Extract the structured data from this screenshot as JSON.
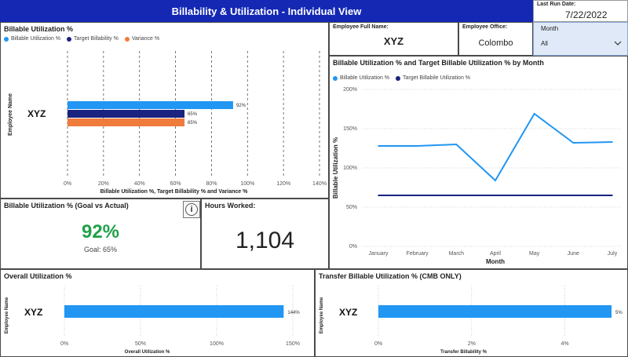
{
  "header": {
    "title": "Billability & Utilization - Individual View",
    "last_run_label": "Last Run Date:",
    "last_run_value": "7/22/2022",
    "brand_color": "#1428b4"
  },
  "filters": {
    "employee_name_label": "Employee Full Name:",
    "employee_name_value": "XYZ",
    "office_label": "Employee Office:",
    "office_value": "Colombo",
    "month_label": "Month",
    "month_value": "All"
  },
  "colors": {
    "billable": "#2196f3",
    "target": "#1a237e",
    "variance": "#ef7b3c",
    "goal_green": "#21a04a"
  },
  "kpi_goal": {
    "title": "Billable Utilization % (Goal vs Actual)",
    "value": "92%",
    "goal_text": "Goal: 65%",
    "info_icon": "info-icon"
  },
  "kpi_hours": {
    "title": "Hours Worked:",
    "value": "1,104"
  },
  "chart_data": [
    {
      "id": "billable_bar",
      "type": "bar",
      "orientation": "horizontal",
      "title": "Billable Utilization %",
      "ylabel": "Employee Name",
      "xlabel": "Billable Utilization %, Target Billability % and Variance %",
      "categories": [
        "XYZ"
      ],
      "series": [
        {
          "name": "Billable Utilization %",
          "values": [
            92
          ],
          "labels": [
            "92%"
          ]
        },
        {
          "name": "Target Billability %",
          "values": [
            65
          ],
          "labels": [
            "65%"
          ]
        },
        {
          "name": "Variance %",
          "values": [
            65
          ],
          "labels": [
            "65%"
          ]
        }
      ],
      "xlim": [
        0,
        140
      ],
      "ticks": [
        "0%",
        "20%",
        "40%",
        "60%",
        "80%",
        "100%",
        "120%",
        "140%"
      ],
      "grid": "vertical dashed",
      "legend": "top-left"
    },
    {
      "id": "monthly_line",
      "type": "line",
      "title": "Billable Utilization % and Target Billable Utilization % by Month",
      "xlabel": "Month",
      "ylabel": "Billable Utilization %",
      "x": [
        "January",
        "February",
        "March",
        "April",
        "May",
        "June",
        "July"
      ],
      "series": [
        {
          "name": "Billable Utilization %",
          "values": [
            128,
            128,
            130,
            84,
            169,
            132,
            133
          ]
        },
        {
          "name": "Target Billabile Utilization %",
          "values": [
            65,
            65,
            65,
            65,
            65,
            65,
            65
          ]
        }
      ],
      "ylim": [
        0,
        200
      ],
      "ticks": [
        "0%",
        "50%",
        "100%",
        "150%",
        "200%"
      ],
      "grid": "horizontal dotted",
      "legend": "top-left"
    },
    {
      "id": "overall_bar",
      "type": "bar",
      "orientation": "horizontal",
      "title": "Overall Utilization %",
      "ylabel": "Employee Name",
      "xlabel": "Overall Utilization %",
      "categories": [
        "XYZ"
      ],
      "series": [
        {
          "name": "Overall Utilization %",
          "values": [
            144
          ],
          "labels": [
            "144%"
          ]
        }
      ],
      "xlim": [
        0,
        150
      ],
      "ticks": [
        "0%",
        "50%",
        "100%",
        "150%"
      ],
      "grid": "vertical dotted"
    },
    {
      "id": "transfer_bar",
      "type": "bar",
      "orientation": "horizontal",
      "title": "Transfer Billable Utilization % (CMB ONLY)",
      "ylabel": "Employee Name",
      "xlabel": "Transfer Billability %",
      "categories": [
        "XYZ"
      ],
      "series": [
        {
          "name": "Transfer Billability %",
          "values": [
            5
          ],
          "labels": [
            "5%"
          ]
        }
      ],
      "xlim": [
        0,
        5
      ],
      "ticks": [
        "0%",
        "2%",
        "4%"
      ],
      "tick_values": [
        0,
        2,
        4
      ],
      "grid": "vertical dotted"
    }
  ]
}
